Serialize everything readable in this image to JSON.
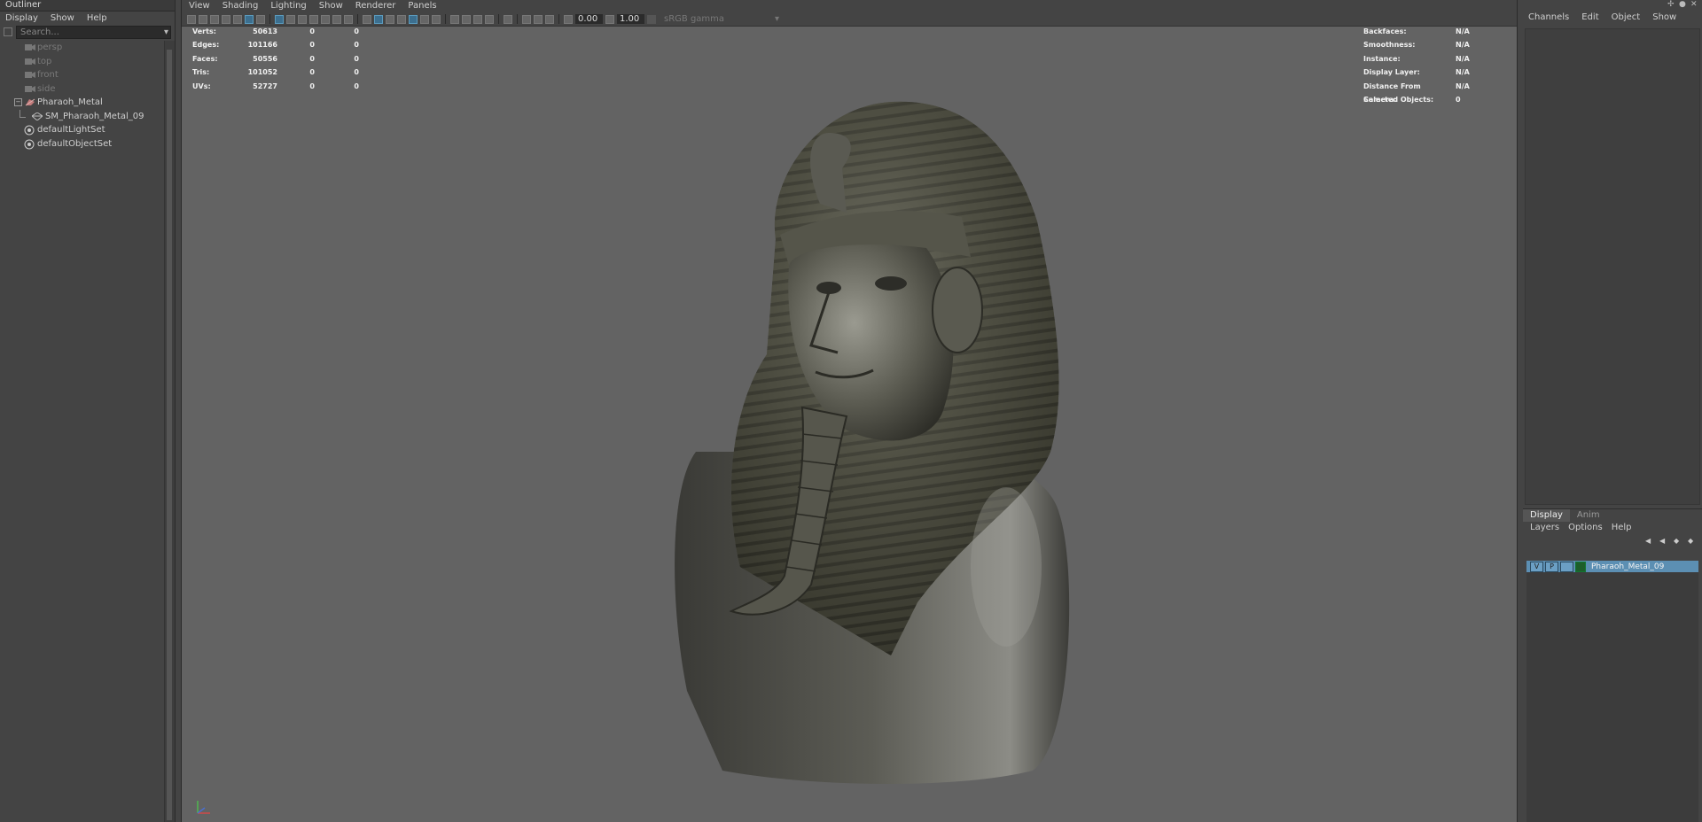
{
  "outliner": {
    "title": "Outliner",
    "menu": [
      "Display",
      "Show",
      "Help"
    ],
    "search_placeholder": "Search...",
    "items": [
      {
        "label": "persp",
        "dim": true
      },
      {
        "label": "top",
        "dim": true
      },
      {
        "label": "front",
        "dim": true
      },
      {
        "label": "side",
        "dim": true
      },
      {
        "label": "Pharaoh_Metal",
        "dim": false
      },
      {
        "label": "SM_Pharaoh_Metal_09",
        "dim": false
      },
      {
        "label": "defaultLightSet",
        "dim": false
      },
      {
        "label": "defaultObjectSet",
        "dim": false
      }
    ]
  },
  "viewport": {
    "menu": [
      "View",
      "Shading",
      "Lighting",
      "Show",
      "Renderer",
      "Panels"
    ],
    "exposure": "0.00",
    "gamma": "1.00",
    "colorspace": "sRGB gamma"
  },
  "hud_left": [
    {
      "label": "Verts:",
      "v1": "50613",
      "v2": "0",
      "v3": "0"
    },
    {
      "label": "Edges:",
      "v1": "101166",
      "v2": "0",
      "v3": "0"
    },
    {
      "label": "Faces:",
      "v1": "50556",
      "v2": "0",
      "v3": "0"
    },
    {
      "label": "Tris:",
      "v1": "101052",
      "v2": "0",
      "v3": "0"
    },
    {
      "label": "UVs:",
      "v1": "52727",
      "v2": "0",
      "v3": "0"
    }
  ],
  "hud_right": [
    {
      "label": "Backfaces:",
      "value": "N/A"
    },
    {
      "label": "Smoothness:",
      "value": "N/A"
    },
    {
      "label": "Instance:",
      "value": "N/A"
    },
    {
      "label": "Display Layer:",
      "value": "N/A"
    },
    {
      "label": "Distance From Camera:",
      "value": "N/A"
    },
    {
      "label": "Selected Objects:",
      "value": "0"
    }
  ],
  "channelbox": {
    "menu": [
      "Channels",
      "Edit",
      "Object",
      "Show"
    ]
  },
  "layers": {
    "tabs": [
      "Display",
      "Anim"
    ],
    "menu": [
      "Layers",
      "Options",
      "Help"
    ],
    "layer": {
      "v": "V",
      "p": "P",
      "name": "Pharaoh_Metal_09"
    }
  },
  "colors": {
    "accent": "#5c8fb3",
    "viewport_bg": "#636363",
    "panel_bg": "#444444"
  }
}
